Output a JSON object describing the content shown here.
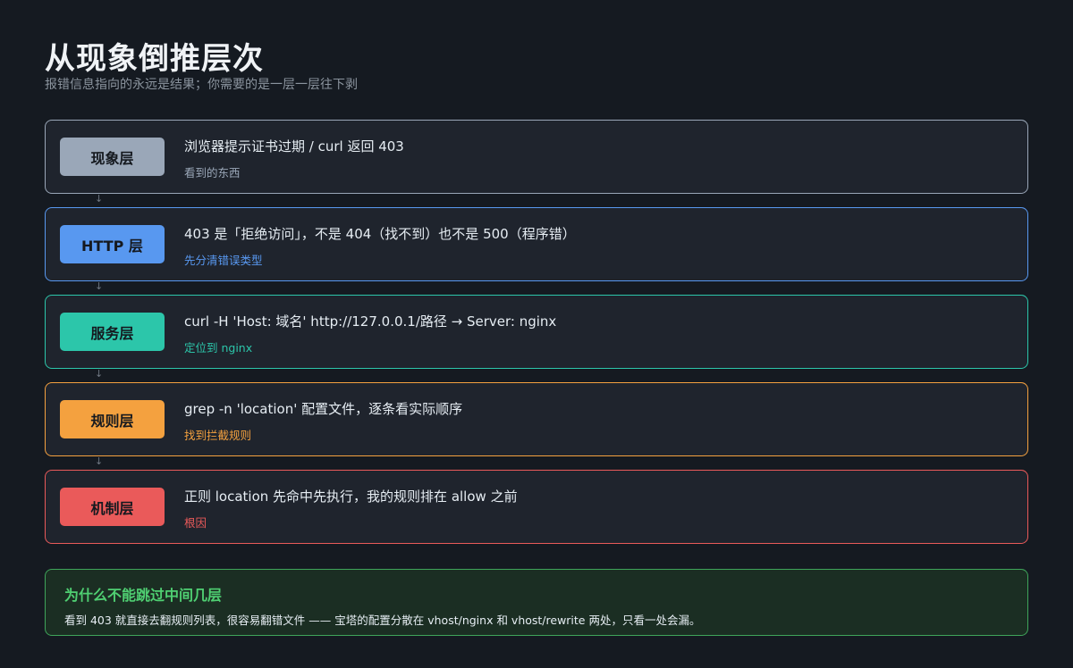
{
  "header": {
    "title": "从现象倒推层次",
    "subtitle": "报错信息指向的永远是结果；你需要的是一层一层往下剥"
  },
  "arrow_glyph": "↓",
  "layers": [
    {
      "badge": "现象层",
      "main": "浏览器提示证书过期 / curl 返回 403",
      "sub": "看到的东西",
      "color": "#9aa7b8",
      "sub_color": "#9aa7b8"
    },
    {
      "badge": "HTTP 层",
      "main": "403 是「拒绝访问」，不是 404（找不到）也不是 500（程序错）",
      "sub": "先分清错误类型",
      "color": "#5898f0",
      "sub_color": "#5898f0"
    },
    {
      "badge": "服务层",
      "main": "curl -H 'Host: 域名' http://127.0.0.1/路径  →  Server: nginx",
      "sub": "定位到 nginx",
      "color": "#2cc6aa",
      "sub_color": "#2cc6aa"
    },
    {
      "badge": "规则层",
      "main": "grep -n 'location' 配置文件，逐条看实际顺序",
      "sub": "找到拦截规则",
      "color": "#f4a13f",
      "sub_color": "#f4a13f"
    },
    {
      "badge": "机制层",
      "main": "正则 location 先命中先执行，我的规则排在 allow 之前",
      "sub": "根因",
      "color": "#ea5a5a",
      "sub_color": "#ea5a5a"
    }
  ],
  "note": {
    "title": "为什么不能跳过中间几层",
    "body": "看到 403 就直接去翻规则列表，很容易翻错文件 —— 宝塔的配置分散在 vhost/nginx 和 vhost/rewrite 两处，只看一处会漏。",
    "color": "#4fcf72"
  }
}
